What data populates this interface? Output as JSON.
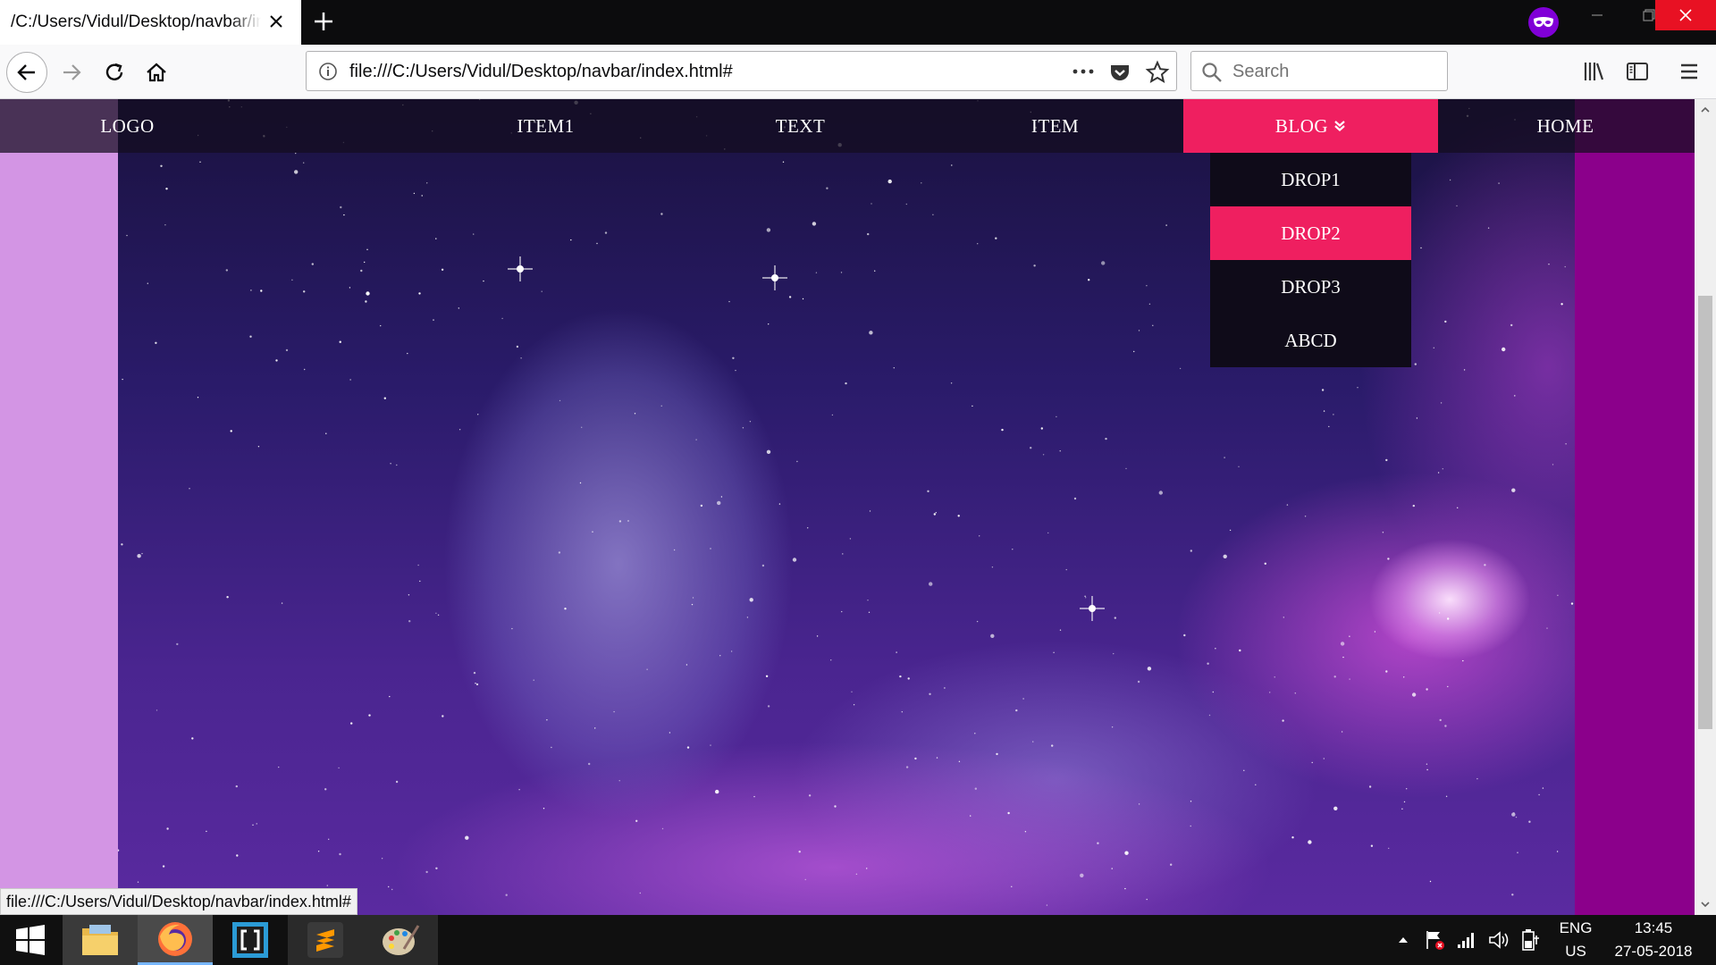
{
  "browser": {
    "tab_title": "/C:/Users/Vidul/Desktop/navbar/index.html#",
    "url": "file:///C:/Users/Vidul/Desktop/navbar/index.html#",
    "search_placeholder": "Search",
    "status_url": "file:///C:/Users/Vidul/Desktop/navbar/index.html#"
  },
  "site_nav": {
    "logo": "LOGO",
    "items": [
      "ITEM1",
      "TEXT",
      "ITEM",
      "BLOG",
      "HOME"
    ],
    "active_item": "BLOG",
    "dropdown": {
      "items": [
        "DROP1",
        "DROP2",
        "DROP3",
        "ABCD"
      ],
      "hovered_item": "DROP2"
    }
  },
  "taskbar": {
    "apps": [
      "file-explorer",
      "firefox",
      "brackets",
      "sublime-text",
      "paint"
    ],
    "language": "ENG",
    "region": "US",
    "time": "13:45",
    "date": "27-05-2018"
  },
  "colors": {
    "accent": "#ef1f60",
    "navbar_bg": "#140c1e",
    "dropdown_bg": "#0f0b19",
    "private_badge": "#8000d7",
    "left_gutter": "#d395e4",
    "right_gutter": "#8b008b"
  }
}
